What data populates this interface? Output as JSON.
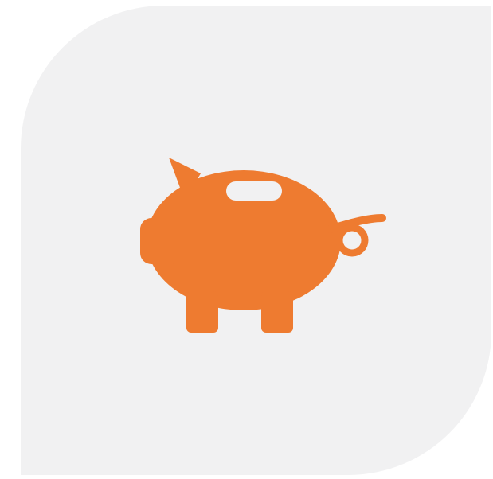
{
  "colors": {
    "page_background": "#ffffff",
    "tile_background": "#f1f1f2",
    "icon_fill": "#ee7b30"
  },
  "tile": {
    "shape": "rounded-leaf",
    "icon": "piggy-bank-icon"
  }
}
